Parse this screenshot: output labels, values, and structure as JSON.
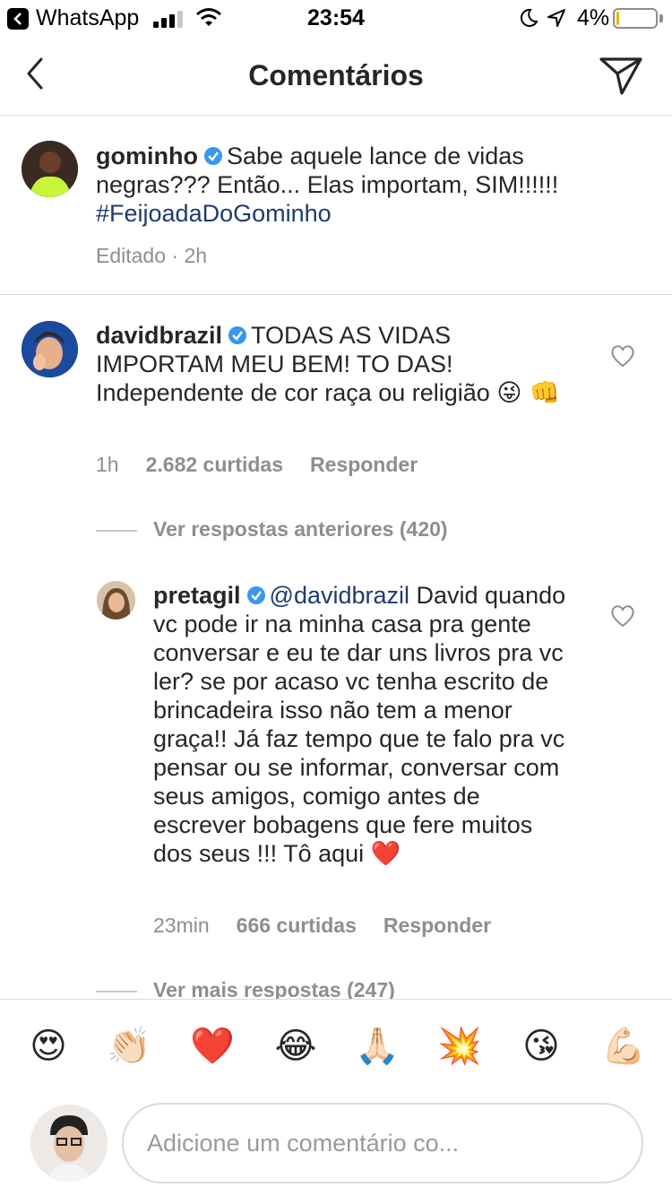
{
  "status_bar": {
    "back_app": "WhatsApp",
    "time": "23:54",
    "battery": "4%"
  },
  "nav": {
    "title": "Comentários"
  },
  "caption": {
    "username": "gominho",
    "text_1": "Sabe aquele lance de vidas negras??? Então... Elas importam, SIM!!!!!! ",
    "hashtag": "#FeijoadaDoGominho",
    "meta": "Editado · 2h"
  },
  "comments": [
    {
      "username": "davidbrazil",
      "text": "TODAS AS VIDAS IMPORTAM MEU BEM! TO DAS! Independente de cor raça ou religião ",
      "emojis": "😜 👊",
      "time": "1h",
      "likes": "2.682 curtidas",
      "reply": "Responder"
    }
  ],
  "view_previous_replies": "Ver respostas anteriores (420)",
  "reply": {
    "username": "pretagil",
    "mention": "@davidbrazil",
    "text": " David quando vc pode ir na minha casa pra gente conversar e eu te dar uns livros pra vc ler? se por acaso vc tenha escrito de brincadeira isso não tem a menor graça!! Já faz tempo que te falo pra vc pensar ou se informar, conversar com seus amigos, comigo antes de escrever bobagens que fere muitos dos seus !!! Tô aqui ",
    "emoji": "❤️",
    "time": "23min",
    "likes": "666 curtidas",
    "reply": "Responder"
  },
  "view_more_replies": "Ver mais respostas (247)",
  "emoji_bar": [
    "😍",
    "👏🏻",
    "❤️",
    "😂",
    "🙏🏻",
    "💥",
    "😘",
    "💪🏻"
  ],
  "composer": {
    "placeholder": "Adicione um comentário co..."
  },
  "colors": {
    "link": "#1d3b6e",
    "verified": "#3897f0",
    "muted": "#8e8e8e"
  }
}
